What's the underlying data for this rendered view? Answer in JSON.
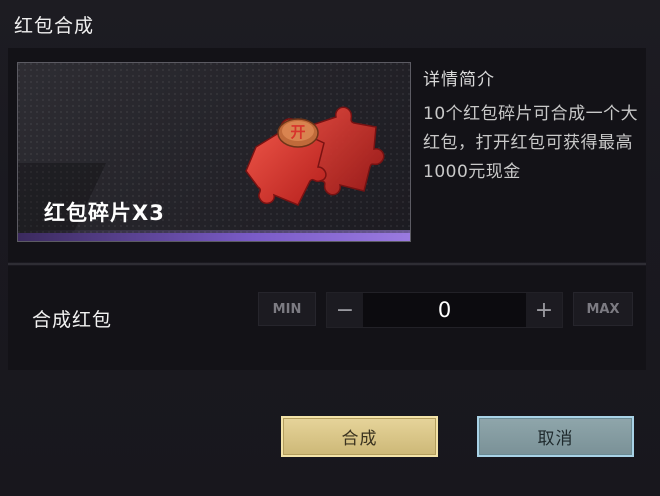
{
  "dialog": {
    "title": "红包合成"
  },
  "item": {
    "name": "红包碎片X3",
    "badge_glyph": "开"
  },
  "detail": {
    "title": "详情简介",
    "description": "10个红包碎片可合成一个大红包，打开红包可获得最高1000元现金"
  },
  "compose": {
    "label": "合成红包",
    "min_label": "MIN",
    "max_label": "MAX",
    "minus_label": "−",
    "plus_label": "+",
    "quantity": "0"
  },
  "actions": {
    "confirm_label": "合成",
    "cancel_label": "取消"
  },
  "colors": {
    "confirm": "#d9c688",
    "cancel": "#869ca1",
    "accent_purple": "#7a5bc7",
    "puzzle_red": "#d8332c"
  }
}
